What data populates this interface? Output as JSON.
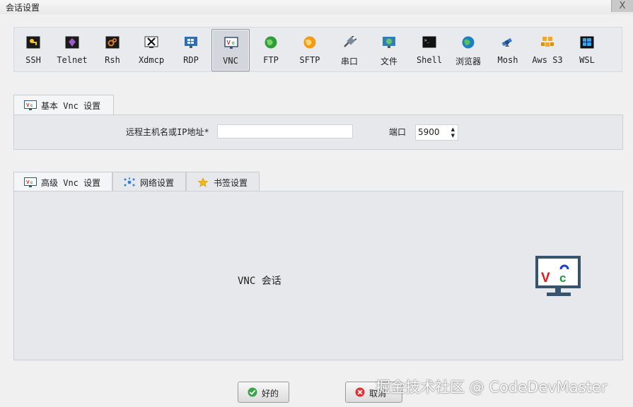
{
  "window": {
    "title": "会话设置",
    "close_label": "X"
  },
  "protocols": [
    {
      "label": "SSH",
      "icon": "key-icon"
    },
    {
      "label": "Telnet",
      "icon": "gem-icon"
    },
    {
      "label": "Rsh",
      "icon": "gears-icon"
    },
    {
      "label": "Xdmcp",
      "icon": "x-icon"
    },
    {
      "label": "RDP",
      "icon": "windows-monitor-icon"
    },
    {
      "label": "VNC",
      "icon": "vnc-icon",
      "selected": true
    },
    {
      "label": "FTP",
      "icon": "globe-icon"
    },
    {
      "label": "SFTP",
      "icon": "orange-globe-icon"
    },
    {
      "label": "串口",
      "icon": "serial-plug-icon"
    },
    {
      "label": "文件",
      "icon": "file-monitor-icon"
    },
    {
      "label": "Shell",
      "icon": "terminal-icon"
    },
    {
      "label": "浏览器",
      "icon": "browser-globe-icon"
    },
    {
      "label": "Mosh",
      "icon": "satellite-icon"
    },
    {
      "label": "Aws S3",
      "icon": "cubes-icon"
    },
    {
      "label": "WSL",
      "icon": "windows-logo-icon"
    }
  ],
  "basic_tab": {
    "label": "基本 Vnc 设置",
    "host_label": "远程主机名或IP地址*",
    "host_value": "",
    "port_label": "端口",
    "port_value": "5900"
  },
  "advanced_tabs": [
    {
      "label": "高级 Vnc 设置",
      "icon": "vnc-icon"
    },
    {
      "label": "网络设置",
      "icon": "network-icon"
    },
    {
      "label": "书签设置",
      "icon": "star-icon"
    }
  ],
  "session_label": "VNC 会话",
  "buttons": {
    "ok": "好的",
    "cancel": "取消"
  },
  "watermark": "掘金技术社区 @ CodeDevMaster",
  "colors": {
    "vnc_red": "#e01a1a",
    "vnc_green": "#1e9a3a",
    "vnc_blue": "#1a3ad6",
    "monitor": "#36546e"
  }
}
